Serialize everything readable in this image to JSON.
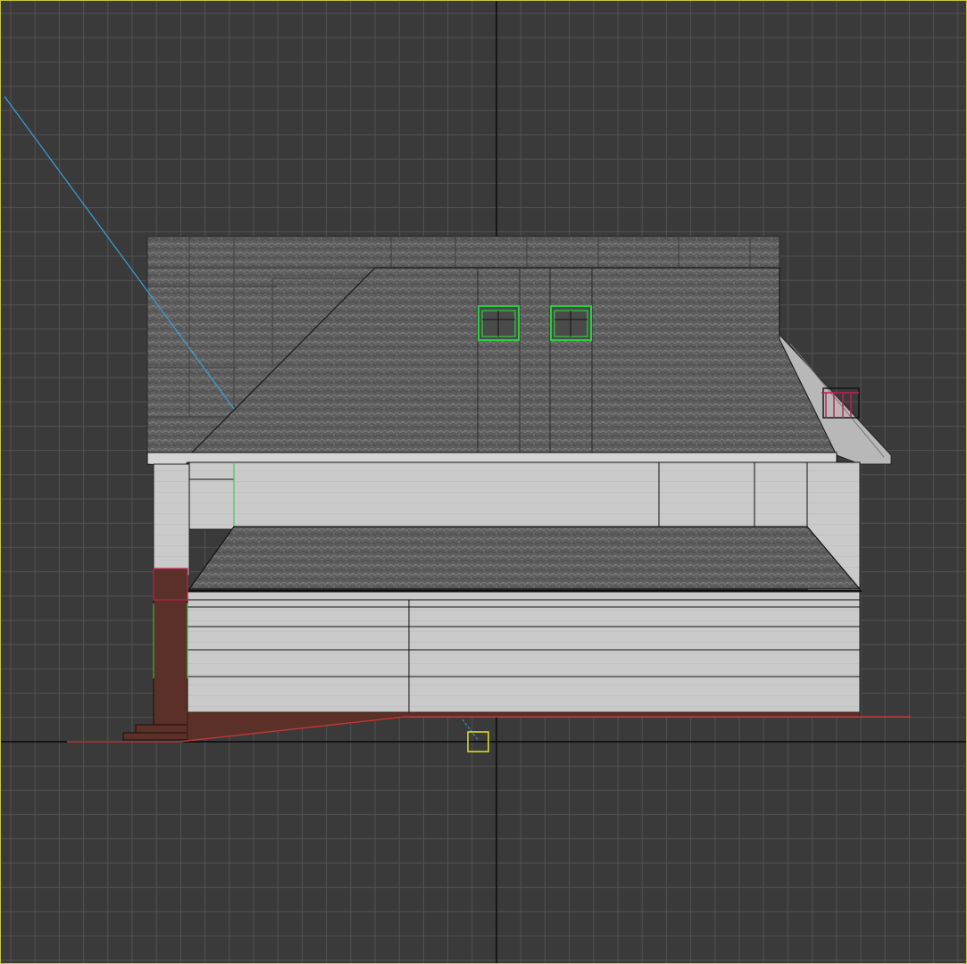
{
  "viewport": {
    "view": "front",
    "grid": true,
    "colors": {
      "background": "#3a3a3a",
      "grid_line": "#525252",
      "axis_line": "#0a0a0a",
      "active_border": "#c8c832",
      "roof": "#5a5a5a",
      "wall": "#c9c9c9",
      "wall_outline": "#101010",
      "foundation": "#5a3028",
      "ground_line": "#b83a3a",
      "camera_line": "#3aa0d8",
      "selected_window": "#2ecc40",
      "railing": "#c02050",
      "target_marker": "#e6e61a"
    },
    "icons": [
      "camera-target-icon"
    ]
  }
}
